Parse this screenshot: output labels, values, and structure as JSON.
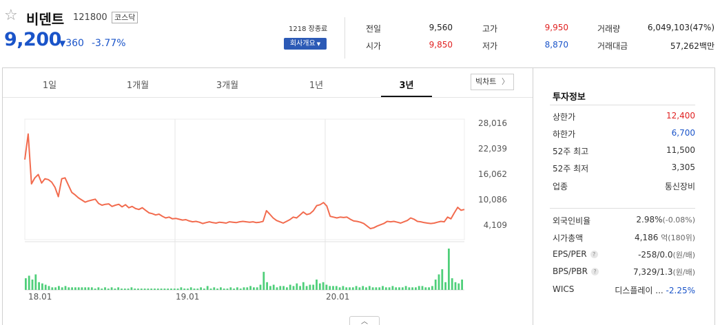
{
  "header": {
    "stock_name": "비덴트",
    "stock_code": "121800",
    "market": "코스닥",
    "price": "9,200",
    "change_arrow": "▼",
    "change_amount": "360",
    "change_percent": "-3.77%",
    "time_status": "1218 장종료",
    "company_button": "회사개요",
    "company_caret": "▼"
  },
  "summary": {
    "prev_close": {
      "label": "전일",
      "value": "9,560"
    },
    "open": {
      "label": "시가",
      "value": "9,850"
    },
    "high": {
      "label": "고가",
      "value": "9,950"
    },
    "low": {
      "label": "저가",
      "value": "8,870"
    },
    "volume": {
      "label": "거래량",
      "value": "6,049,103(47%)"
    },
    "trade_amount": {
      "label": "거래대금",
      "value": "57,262백만"
    }
  },
  "tabs": [
    {
      "label": "1일"
    },
    {
      "label": "1개월"
    },
    {
      "label": "3개월"
    },
    {
      "label": "1년"
    },
    {
      "label": "3년"
    }
  ],
  "active_tab": "3년",
  "big_chart_button": "빅차트",
  "big_chart_arrow": "〉",
  "scroll_handle": "︿",
  "colors": {
    "up": "#e02020",
    "down": "#1a54c9",
    "line": "#f26b4e",
    "volume": "#4fcf7a"
  },
  "chart_data": {
    "type": "line",
    "y_ticks": [
      "28,016",
      "22,039",
      "16,062",
      "10,086",
      "4,109"
    ],
    "y_tick_values": [
      28016,
      22039,
      16062,
      10086,
      4109
    ],
    "x_ticks": [
      "18.01",
      "19.01",
      "20.01"
    ],
    "series": [
      {
        "values": [
          19500,
          25500,
          13800,
          15200,
          16000,
          14000,
          15000,
          14800,
          14200,
          13000,
          10800,
          15000,
          15200,
          13500,
          11800,
          11200,
          10500,
          10000,
          9500,
          9800,
          10000,
          10200,
          9200,
          8800,
          9000,
          9100,
          8500,
          8800,
          9000,
          8400,
          8900,
          8200,
          8500,
          8000,
          7800,
          8200,
          7600,
          7000,
          6800,
          6500,
          6700,
          6200,
          5800,
          6000,
          5600,
          5700,
          5500,
          5300,
          5400,
          5100,
          4900,
          5000,
          4800,
          4500,
          4700,
          4900,
          4700,
          4600,
          4800,
          4700,
          4600,
          4900,
          4800,
          4700,
          4900,
          5000,
          4900,
          4800,
          4900,
          4700,
          4800,
          5000,
          7500,
          6700,
          5800,
          5200,
          4900,
          4600,
          5000,
          5400,
          6000,
          5800,
          6500,
          7200,
          6600,
          6800,
          7500,
          8700,
          8900,
          9400,
          8600,
          6200,
          6000,
          5800,
          6000,
          5900,
          6000,
          5500,
          5100,
          5000,
          4800,
          4500,
          3900,
          3300,
          3500,
          3900,
          4200,
          4500,
          5000,
          4900,
          5000,
          4800,
          4600,
          4900,
          5200,
          5800,
          5500,
          5000,
          4900,
          4700,
          4600,
          4500,
          4600,
          4800,
          5000,
          4900,
          6000,
          5600,
          7000,
          8300,
          7600,
          7800
        ]
      }
    ],
    "volume": [
      9,
      11,
      8,
      12,
      6,
      5,
      4,
      3,
      2,
      2,
      3,
      2,
      3,
      2,
      2,
      2,
      2,
      2,
      2,
      2,
      2,
      1,
      2,
      1,
      2,
      1,
      2,
      1,
      2,
      1,
      1,
      1,
      2,
      1,
      1,
      1,
      1,
      1,
      1,
      1,
      1,
      1,
      1,
      1,
      1,
      1,
      1,
      2,
      1,
      1,
      2,
      1,
      1,
      2,
      1,
      3,
      1,
      2,
      1,
      2,
      1,
      1,
      2,
      1,
      2,
      1,
      2,
      2,
      3,
      2,
      2,
      4,
      14,
      6,
      3,
      4,
      2,
      3,
      3,
      2,
      4,
      3,
      5,
      3,
      6,
      3,
      4,
      4,
      8,
      5,
      6,
      4,
      3,
      3,
      3,
      2,
      3,
      2,
      2,
      2,
      3,
      2,
      3,
      2,
      3,
      2,
      2,
      2,
      3,
      2,
      2,
      3,
      2,
      2,
      2,
      3,
      2,
      2,
      2,
      3,
      3,
      2,
      2,
      3,
      8,
      12,
      16,
      6,
      32,
      9,
      6,
      5,
      8
    ]
  },
  "info": {
    "title": "투자정보",
    "rows_top": [
      {
        "label": "상한가",
        "value": "12,400",
        "color": "up"
      },
      {
        "label": "하한가",
        "value": "6,700",
        "color": "down"
      },
      {
        "label": "52주 최고",
        "value": "11,500",
        "color": "plain"
      },
      {
        "label": "52주 최저",
        "value": "3,305",
        "color": "plain"
      },
      {
        "label": "업종",
        "value": "통신장비",
        "color": "plain"
      }
    ],
    "foreign_ratio": {
      "label": "외국인비율",
      "value": "2.98%",
      "sub": "(-0.08%)"
    },
    "market_cap": {
      "label": "시가총액",
      "value": "4,186",
      "unit": "억(180위)"
    },
    "eps_per": {
      "label": "EPS/PER",
      "value": "-258/0.0",
      "unit": "(원/배)",
      "help": "?"
    },
    "bps_pbr": {
      "label": "BPS/PBR",
      "value": "7,329/1.3",
      "unit": "(원/배)",
      "help": "?"
    },
    "wics": {
      "label": "WICS",
      "value": "디스플레이 ...",
      "change": "-2.25%"
    }
  }
}
